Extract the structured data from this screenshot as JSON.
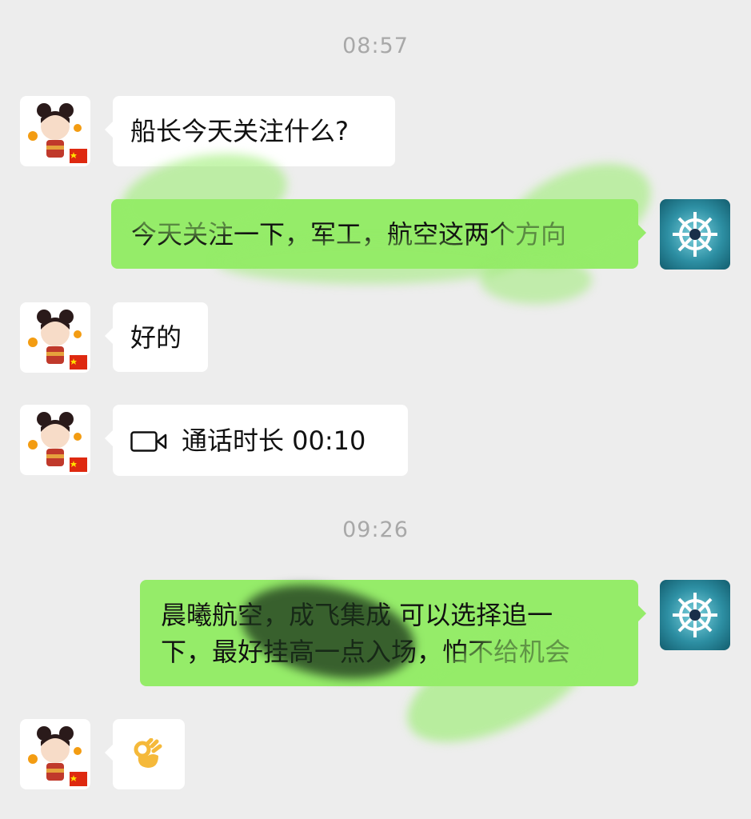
{
  "timestamps": [
    "08:57",
    "09:26"
  ],
  "messages": [
    {
      "from": "contact",
      "text": "船长今天关注什么?"
    },
    {
      "from": "me",
      "text": "今天关注一下，军工，航空这两个方向"
    },
    {
      "from": "contact",
      "text": "好的"
    },
    {
      "from": "contact",
      "type": "video-call",
      "icon": "video-camera-icon",
      "text": "通话时长 00:10"
    },
    {
      "from": "me",
      "lines": [
        "晨曦航空，成飞集成 可以选择追一",
        "下，最好挂高一点入场，怕不给机会"
      ]
    },
    {
      "from": "contact",
      "type": "emoji",
      "icon": "ok-hand-emoji",
      "text": "👌"
    }
  ],
  "colors": {
    "background": "#ededed",
    "incoming_bubble": "#ffffff",
    "outgoing_bubble": "#95ec69",
    "timestamp": "#a8a8a8"
  },
  "avatars": {
    "contact": "cartoon-girl-avatar",
    "me": "ship-wheel-avatar"
  }
}
